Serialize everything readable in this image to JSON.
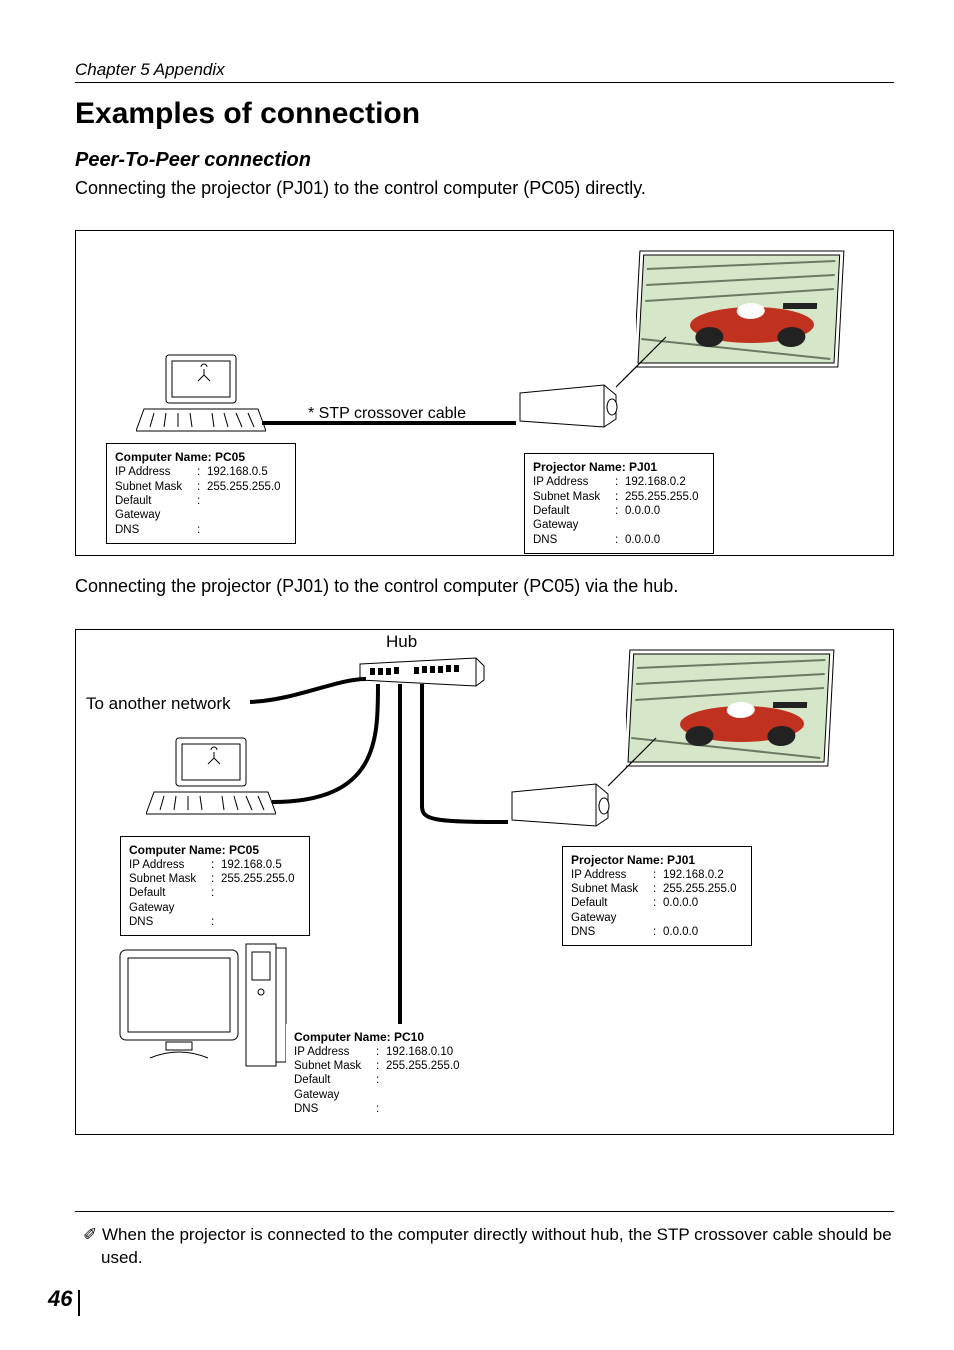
{
  "chapter": "Chapter 5 Appendix",
  "h1": "Examples of connection",
  "h2": "Peer-To-Peer connection",
  "para1": "Connecting the projector (PJ01) to the control computer (PC05) directly.",
  "para2": "Connecting the projector (PJ01) to the control computer (PC05) via the hub.",
  "cable_label": "* STP crossover cable",
  "hub_label": "Hub",
  "to_another": "To another network",
  "footnote": "When the projector is connected to the computer directly without hub, the STP crossover cable should be used.",
  "footnote_mark": "✐",
  "page": "46",
  "boxes": {
    "pc05a": {
      "title": "Computer Name: PC05",
      "rows": [
        [
          "IP Address",
          "192.168.0.5"
        ],
        [
          "Subnet Mask",
          "255.255.255.0"
        ],
        [
          "Default Gateway",
          ""
        ],
        [
          "DNS",
          ""
        ]
      ]
    },
    "pj01a": {
      "title": "Projector Name: PJ01",
      "rows": [
        [
          "IP Address",
          "192.168.0.2"
        ],
        [
          "Subnet Mask",
          "255.255.255.0"
        ],
        [
          "Default Gateway",
          "0.0.0.0"
        ],
        [
          "DNS",
          "0.0.0.0"
        ]
      ]
    },
    "pc05b": {
      "title": "Computer Name: PC05",
      "rows": [
        [
          "IP Address",
          "192.168.0.5"
        ],
        [
          "Subnet Mask",
          "255.255.255.0"
        ],
        [
          "Default Gateway",
          ""
        ],
        [
          "DNS",
          ""
        ]
      ]
    },
    "pj01b": {
      "title": "Projector Name: PJ01",
      "rows": [
        [
          "IP Address",
          "192.168.0.2"
        ],
        [
          "Subnet Mask",
          "255.255.255.0"
        ],
        [
          "Default Gateway",
          "0.0.0.0"
        ],
        [
          "DNS",
          "0.0.0.0"
        ]
      ]
    },
    "pc10": {
      "title": "Computer Name: PC10",
      "rows": [
        [
          "IP Address",
          "192.168.0.10"
        ],
        [
          "Subnet Mask",
          "255.255.255.0"
        ],
        [
          "Default Gateway",
          ""
        ],
        [
          "DNS",
          ""
        ]
      ]
    }
  }
}
